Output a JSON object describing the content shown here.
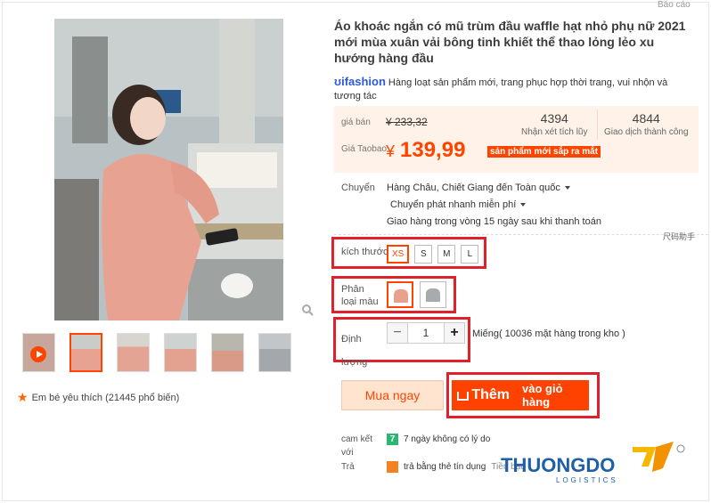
{
  "report_link": "Báo cáo",
  "product": {
    "title": "Áo khoác ngắn có mũ trùm đầu waffle hạt nhỏ phụ nữ 2021 mới mùa xuân vải bông tinh khiết thể thao lỏng lẻo xu hướng hàng đầu",
    "brand_logo": "ifashion",
    "brand_desc": "Hàng loạt sản phẩm mới, trang phục hợp thời trang, vui nhộn và tương tác"
  },
  "price": {
    "orig_label": "giá bán",
    "orig_value": "¥ 233,32",
    "taobao_label": "Giá Taobao",
    "currency": "¥",
    "taobao_value": "139,99",
    "badge": "sản phẩm mới sắp ra mắt",
    "reviews_count": "4394",
    "reviews_label": "Nhận xét tích lũy",
    "trades_count": "4844",
    "trades_label": "Giao dịch thành công"
  },
  "shipping": {
    "label": "Chuyển",
    "route": "Hàng Châu, Chiết Giang đến Toàn quốc",
    "method": "Chuyển phát nhanh miễn phí",
    "note": "Giao hàng trong vòng 15 ngày sau khi thanh toán",
    "size_help": "尺码助手"
  },
  "size": {
    "label": "kích thước",
    "options": [
      "XS",
      "S",
      "M",
      "L"
    ],
    "selected": "XS"
  },
  "color": {
    "label": "Phân loại màu",
    "options": [
      {
        "name": "hồng",
        "hex": "#e9a08c"
      },
      {
        "name": "xám",
        "hex": "#a7aaae"
      }
    ]
  },
  "quantity": {
    "label": "Định lượng",
    "minus": "−",
    "value": "1",
    "plus": "+",
    "stock": "Miếng( 10036 mặt hàng trong kho )"
  },
  "actions": {
    "buy_now": "Mua ngay",
    "add_cart_1": "Thêm",
    "add_cart_2": "vào giỏ hàng"
  },
  "services": {
    "commit_label": "cam kết với",
    "commit_value": "7 ngày không có lý do",
    "commit_icon": "7",
    "pay_label": "Trả",
    "pay_value": "trả bằng thẻ tín dụng",
    "pay_extra": "Tiền bạc"
  },
  "gallery": {
    "favorites": "Em bé yêu thích (21445 phổ biến)"
  },
  "watermark": {
    "name": "THUONGDO",
    "sub": "LOGISTICS"
  },
  "colors": {
    "accent": "#ff4400",
    "price_bg": "#fff2e8",
    "highlight": "#e0202a"
  }
}
